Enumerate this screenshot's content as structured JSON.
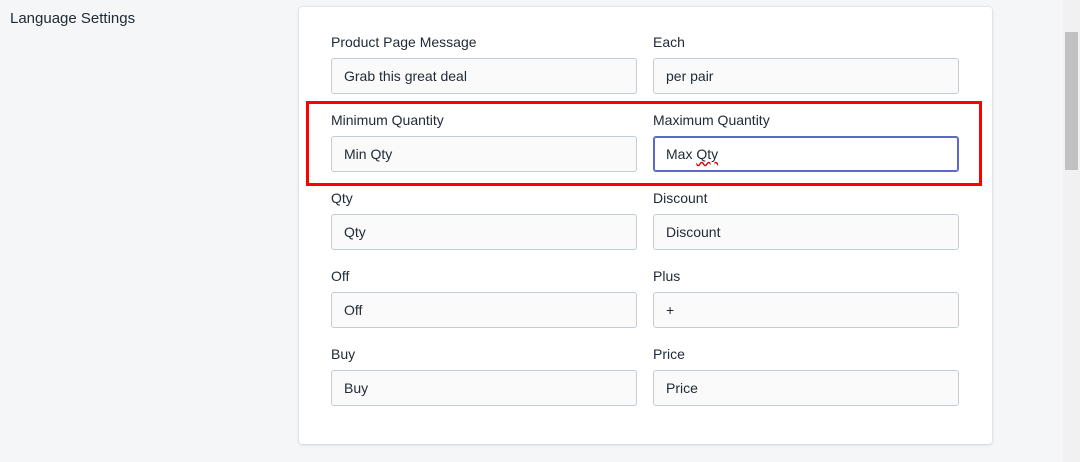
{
  "section": {
    "title": "Language Settings"
  },
  "fields": {
    "product_page_message": {
      "label": "Product Page Message",
      "value": "Grab this great deal"
    },
    "each": {
      "label": "Each",
      "value": "per pair"
    },
    "minimum_quantity": {
      "label": "Minimum Quantity",
      "value": "Min Qty"
    },
    "maximum_quantity": {
      "label": "Maximum Quantity",
      "value_prefix": "Max ",
      "value_misspelled": "Qty"
    },
    "qty": {
      "label": "Qty",
      "value": "Qty"
    },
    "discount": {
      "label": "Discount",
      "value": "Discount"
    },
    "off": {
      "label": "Off",
      "value": "Off"
    },
    "plus": {
      "label": "Plus",
      "value": "+"
    },
    "buy": {
      "label": "Buy",
      "value": "Buy"
    },
    "price": {
      "label": "Price",
      "value": "Price"
    }
  },
  "colors": {
    "highlight": "#ff0000",
    "focus_border": "#5c6ac4"
  }
}
